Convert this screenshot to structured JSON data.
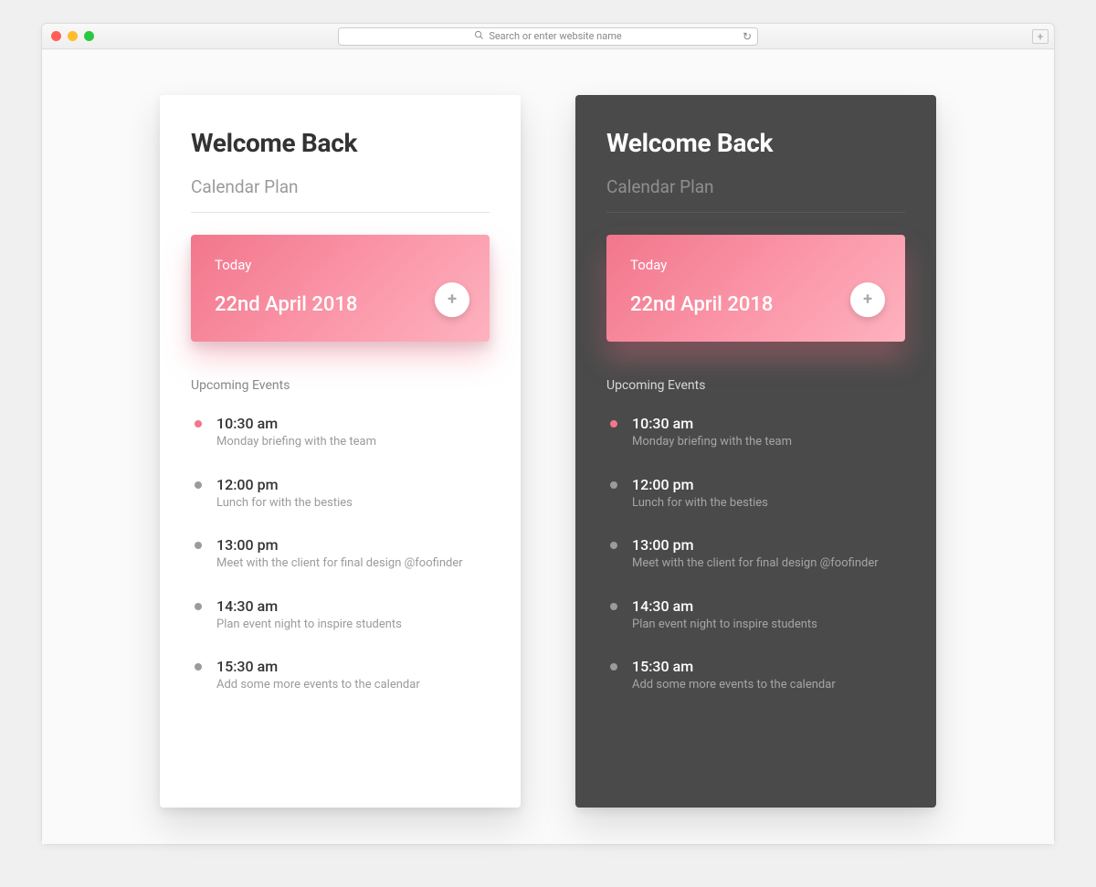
{
  "browser": {
    "address_placeholder": "Search or enter website name"
  },
  "light": {
    "title": "Welcome Back",
    "subtitle": "Calendar Plan",
    "today_label": "Today",
    "today_date": "22nd April 2018",
    "section": "Upcoming Events",
    "events": [
      {
        "time": "10:30 am",
        "desc": "Monday briefing with the team",
        "active": true
      },
      {
        "time": "12:00 pm",
        "desc": "Lunch for with the besties",
        "active": false
      },
      {
        "time": "13:00 pm",
        "desc": "Meet with the client for final design @foofinder",
        "active": false
      },
      {
        "time": "14:30 am",
        "desc": "Plan event night to inspire students",
        "active": false
      },
      {
        "time": "15:30 am",
        "desc": "Add some more events to the calendar",
        "active": false
      }
    ]
  },
  "dark": {
    "title": "Welcome Back",
    "subtitle": "Calendar Plan",
    "today_label": "Today",
    "today_date": "22nd April 2018",
    "section": "Upcoming Events",
    "events": [
      {
        "time": "10:30 am",
        "desc": "Monday briefing with the team",
        "active": true
      },
      {
        "time": "12:00 pm",
        "desc": "Lunch for with the besties",
        "active": false
      },
      {
        "time": "13:00 pm",
        "desc": "Meet with the client for final design @foofinder",
        "active": false
      },
      {
        "time": "14:30 am",
        "desc": "Plan event night to inspire students",
        "active": false
      },
      {
        "time": "15:30 am",
        "desc": "Add some more events to the calendar",
        "active": false
      }
    ]
  }
}
